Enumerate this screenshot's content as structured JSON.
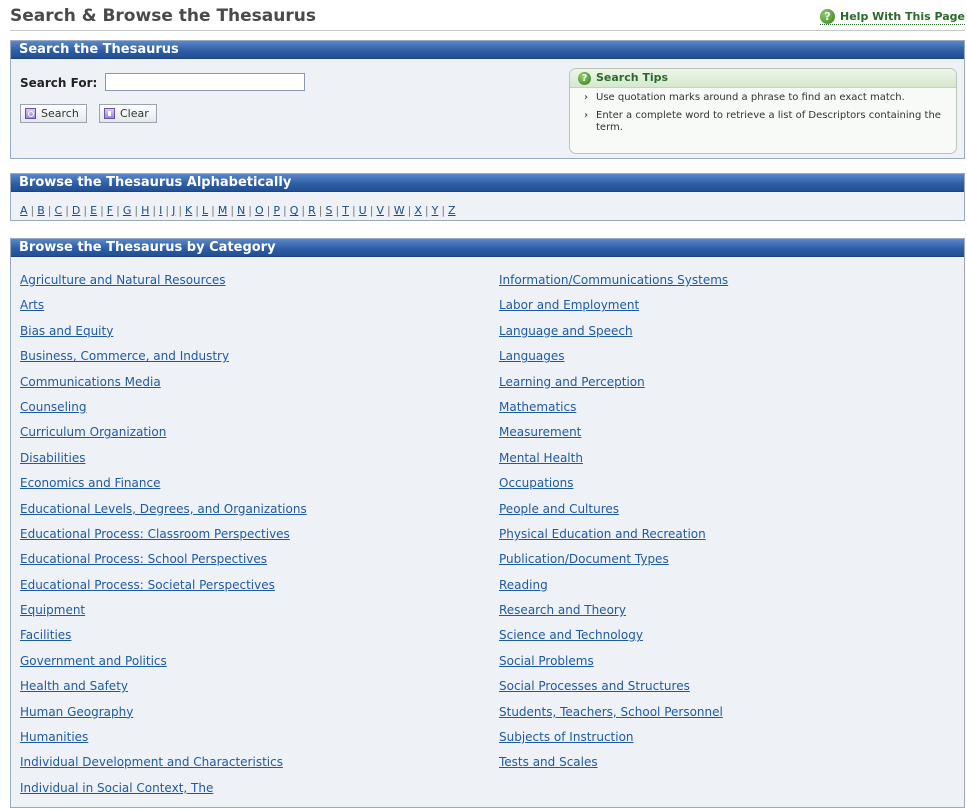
{
  "header": {
    "title": "Search & Browse the Thesaurus",
    "help_label": "Help With This Page"
  },
  "search": {
    "section_title": "Search the Thesaurus",
    "label": "Search For:",
    "value": "",
    "placeholder": "",
    "search_button": "Search",
    "clear_button": "Clear"
  },
  "tips": {
    "title": "Search Tips",
    "items": [
      "Use quotation marks around a phrase to find an exact match.",
      "Enter a complete word to retrieve a list of Descriptors containing the term."
    ]
  },
  "alpha": {
    "section_title": "Browse the Thesaurus Alphabetically",
    "letters": [
      "A",
      "B",
      "C",
      "D",
      "E",
      "F",
      "G",
      "H",
      "I",
      "J",
      "K",
      "L",
      "M",
      "N",
      "O",
      "P",
      "Q",
      "R",
      "S",
      "T",
      "U",
      "V",
      "W",
      "X",
      "Y",
      "Z"
    ]
  },
  "categories": {
    "section_title": "Browse the Thesaurus by Category",
    "left": [
      "Agriculture and Natural Resources",
      "Arts",
      "Bias and Equity",
      "Business, Commerce, and Industry",
      "Communications Media",
      "Counseling",
      "Curriculum Organization",
      "Disabilities",
      "Economics and Finance",
      "Educational Levels, Degrees, and Organizations",
      "Educational Process: Classroom Perspectives",
      "Educational Process: School Perspectives",
      "Educational Process: Societal Perspectives",
      "Equipment",
      "Facilities",
      "Government and Politics",
      "Health and Safety",
      "Human Geography",
      "Humanities",
      "Individual Development and Characteristics",
      "Individual in Social Context, The"
    ],
    "right": [
      "Information/Communications Systems",
      "Labor and Employment",
      "Language and Speech",
      "Languages",
      "Learning and Perception",
      "Mathematics",
      "Measurement",
      "Mental Health",
      "Occupations",
      "People and Cultures",
      "Physical Education and Recreation",
      "Publication/Document Types",
      "Reading",
      "Research and Theory",
      "Science and Technology",
      "Social Problems",
      "Social Processes and Structures",
      "Students, Teachers, School Personnel",
      "Subjects of Instruction",
      "Tests and Scales"
    ]
  }
}
